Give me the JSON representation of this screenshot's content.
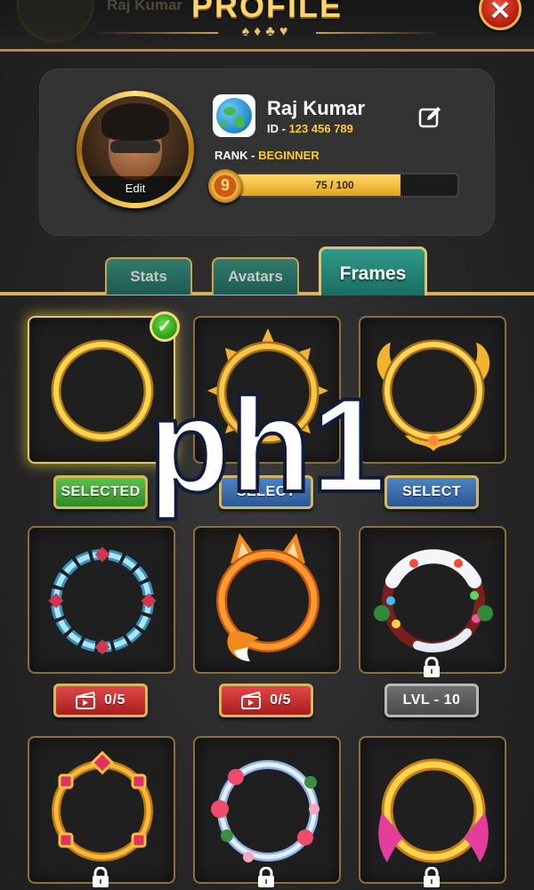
{
  "header": {
    "title": "PROFILE",
    "suits": "♠♦♣♥",
    "ghost_name": "Raj Kumar",
    "close_icon": "close-icon"
  },
  "profile": {
    "avatar_edit_label": "Edit",
    "flag_icon": "globe-icon",
    "name": "Raj Kumar",
    "id_label": "ID - ",
    "id_value": "123 456 789",
    "rank_label": "RANK - ",
    "rank_value": "BEGINNER",
    "level": "9",
    "xp_text": "75 / 100",
    "xp_fraction": 0.75,
    "edit_icon": "edit-icon"
  },
  "tabs": [
    {
      "label": "Stats",
      "active": false
    },
    {
      "label": "Avatars",
      "active": false
    },
    {
      "label": "Frames",
      "active": true
    }
  ],
  "frames": [
    {
      "style": "plain-gold-ring",
      "status": "selected",
      "button": "SELECTED",
      "locked": false
    },
    {
      "style": "spiked-gold-ring",
      "status": "select",
      "button": "SELECT",
      "locked": false
    },
    {
      "style": "ornate-gold-ring",
      "status": "select",
      "button": "SELECT",
      "locked": false
    },
    {
      "style": "ice-crystal-ring",
      "status": "video",
      "button": "0/5",
      "locked": false
    },
    {
      "style": "fox-ring",
      "status": "video",
      "button": "0/5",
      "locked": false
    },
    {
      "style": "christmas-wreath-ring",
      "status": "level",
      "button": "LVL - 10",
      "locked": true
    },
    {
      "style": "jeweled-ring",
      "status": "locked",
      "button": "",
      "locked": true
    },
    {
      "style": "floral-ring",
      "status": "locked",
      "button": "",
      "locked": true
    },
    {
      "style": "ribbon-ring",
      "status": "locked",
      "button": "",
      "locked": true
    }
  ],
  "placeholder_text": "ph1",
  "colors": {
    "gold": "#d4b25a",
    "tab_teal": "#2f9a8a",
    "btn_green": "#3fa332",
    "btn_blue": "#3a6cb0",
    "btn_red": "#c43030",
    "btn_gray": "#5c5c5c"
  }
}
